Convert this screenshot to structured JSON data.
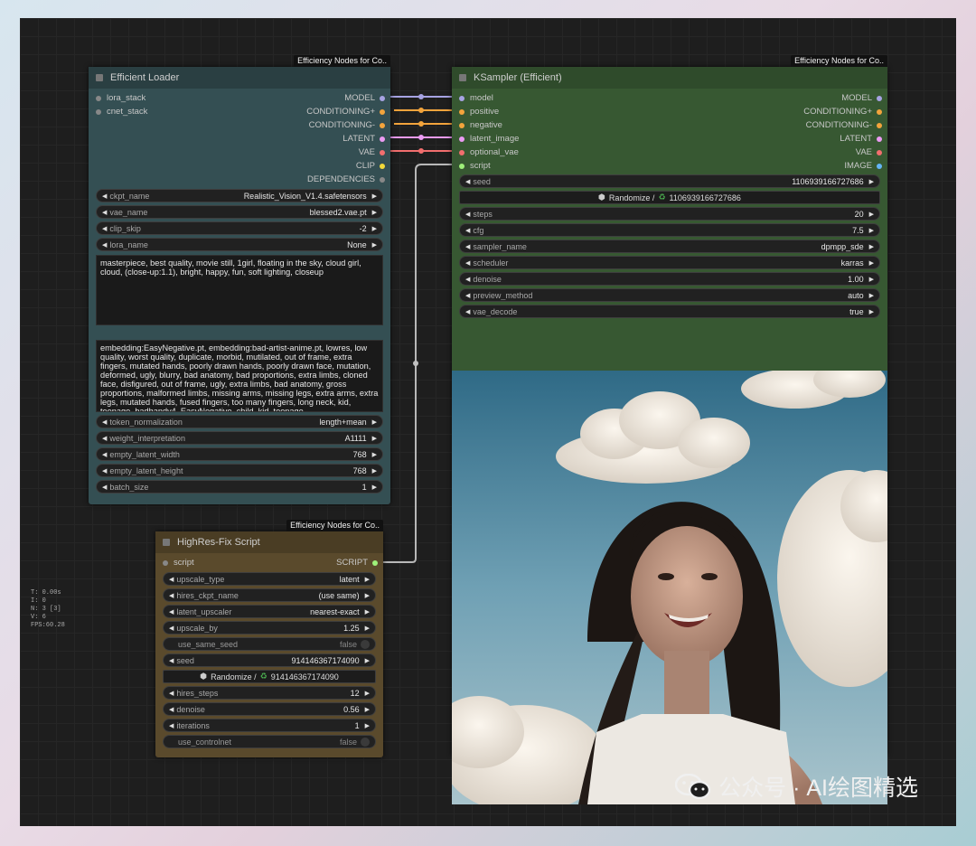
{
  "colors": {
    "model": "#a7a3e3",
    "conditioning": "#f3a43c",
    "latent": "#ec9bf3",
    "vae": "#f26e6e",
    "clip": "#f2d93a",
    "script": "#9ef07a",
    "image": "#64b5f6",
    "loader_body": "#344f53",
    "loader_header": "#2a3f42",
    "ksampler_body": "#375832",
    "ksampler_header": "#2f4b2b",
    "highres_body": "#5a4a2c",
    "highres_header": "#4a3d24"
  },
  "efficient_loader": {
    "badge": "Efficiency Nodes for Co..",
    "title": "Efficient Loader",
    "inputs": [
      "lora_stack",
      "cnet_stack"
    ],
    "outputs": [
      "MODEL",
      "CONDITIONING+",
      "CONDITIONING-",
      "LATENT",
      "VAE",
      "CLIP",
      "DEPENDENCIES"
    ],
    "widgets_top": [
      {
        "label": "ckpt_name",
        "value": "Realistic_Vision_V1.4.safetensors"
      },
      {
        "label": "vae_name",
        "value": "blessed2.vae.pt"
      },
      {
        "label": "clip_skip",
        "value": "-2"
      },
      {
        "label": "lora_name",
        "value": "None"
      }
    ],
    "positive_prompt": "masterpiece, best quality, movie still, 1girl, floating in the sky, cloud girl, cloud, (close-up:1.1), bright, happy, fun, soft lighting, closeup",
    "negative_prompt": "embedding:EasyNegative.pt, embedding:bad-artist-anime.pt, lowres, low quality, worst quality, duplicate, morbid, mutilated, out of frame, extra fingers, mutated hands, poorly drawn hands, poorly drawn face, mutation, deformed, ugly, blurry, bad anatomy, bad proportions, extra limbs, cloned face, disfigured, out of frame, ugly, extra limbs, bad anatomy, gross proportions, malformed limbs, missing arms, missing legs, extra arms, extra legs, mutated hands, fused fingers, too many fingers, long neck, kid, teenage, badhandv4, EasyNegative, child, kid, teenage",
    "widgets_bottom": [
      {
        "label": "token_normalization",
        "value": "length+mean"
      },
      {
        "label": "weight_interpretation",
        "value": "A1111"
      },
      {
        "label": "empty_latent_width",
        "value": "768"
      },
      {
        "label": "empty_latent_height",
        "value": "768"
      },
      {
        "label": "batch_size",
        "value": "1"
      }
    ]
  },
  "ksampler": {
    "badge": "Efficiency Nodes for Co..",
    "title": "KSampler (Efficient)",
    "inputs": [
      "model",
      "positive",
      "negative",
      "latent_image",
      "optional_vae",
      "script"
    ],
    "outputs": [
      "MODEL",
      "CONDITIONING+",
      "CONDITIONING-",
      "LATENT",
      "VAE",
      "IMAGE"
    ],
    "seed": {
      "label": "seed",
      "value": "1106939166727686"
    },
    "randomize": "Randomize /",
    "randomize_seed": "1106939166727686",
    "widgets": [
      {
        "label": "steps",
        "value": "20"
      },
      {
        "label": "cfg",
        "value": "7.5"
      },
      {
        "label": "sampler_name",
        "value": "dpmpp_sde"
      },
      {
        "label": "scheduler",
        "value": "karras"
      },
      {
        "label": "denoise",
        "value": "1.00"
      },
      {
        "label": "preview_method",
        "value": "auto"
      },
      {
        "label": "vae_decode",
        "value": "true"
      }
    ]
  },
  "highres": {
    "badge": "Efficiency Nodes for Co..",
    "title": "HighRes-Fix Script",
    "input": "script",
    "output": "SCRIPT",
    "widgets_a": [
      {
        "label": "upscale_type",
        "value": "latent"
      },
      {
        "label": "hires_ckpt_name",
        "value": "(use same)"
      },
      {
        "label": "latent_upscaler",
        "value": "nearest-exact"
      },
      {
        "label": "upscale_by",
        "value": "1.25"
      }
    ],
    "toggle_seed": {
      "label": "use_same_seed",
      "value": "false"
    },
    "seed": {
      "label": "seed",
      "value": "914146367174090"
    },
    "randomize": "Randomize /",
    "randomize_seed": "914146367174090",
    "widgets_b": [
      {
        "label": "hires_steps",
        "value": "12"
      },
      {
        "label": "denoise",
        "value": "0.56"
      },
      {
        "label": "iterations",
        "value": "1"
      }
    ],
    "toggle_controlnet": {
      "label": "use_controlnet",
      "value": "false"
    }
  },
  "stats": [
    "T: 0.00s",
    "I: 0",
    "N: 3 [3]",
    "V: 6",
    "FPS:60.28"
  ],
  "watermark": "公众号 · AI绘图精选"
}
